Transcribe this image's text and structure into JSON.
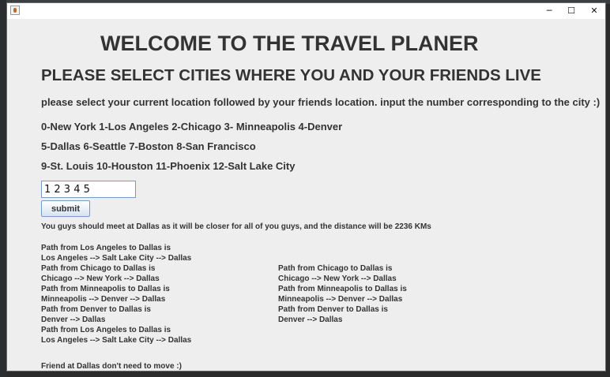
{
  "window": {
    "controls": {
      "minimize": "─",
      "maximize": "☐",
      "close": "✕"
    }
  },
  "header": {
    "title": "WELCOME TO THE TRAVEL PLANER",
    "subtitle": "PLEASE SELECT CITIES WHERE YOU AND YOUR FRIENDS LIVE",
    "instruction": "please select your current location followed by your friends location. input the number corresponding to the city :)"
  },
  "cities": [
    "0-New York 1-Los Angeles  2-Chicago 3- Minneapolis 4-Denver",
    "5-Dallas 6-Seattle 7-Boston 8-San Francisco",
    "9-St. Louis 10-Houston 11-Phoenix 12-Salt Lake City"
  ],
  "form": {
    "input_value": "1 2 3 4 5",
    "submit_label": "submit"
  },
  "result": "You guys should meet at Dallas as it will be closer for all of you guys, and the distance will be 2236 KMs",
  "paths_left": [
    "Path from Los Angeles to Dallas is",
    "Los Angeles --> Salt Lake City --> Dallas",
    "Path from Chicago to Dallas is",
    "Chicago --> New York --> Dallas",
    "Path from Minneapolis to Dallas is",
    "Minneapolis --> Denver --> Dallas",
    "Path from Denver to Dallas is",
    "Denver --> Dallas",
    "Path from Los Angeles to Dallas is",
    "Los Angeles --> Salt Lake City --> Dallas"
  ],
  "paths_right": [
    "Path from Chicago to Dallas is",
    "Chicago --> New York --> Dallas",
    "Path from Minneapolis to Dallas is",
    "Minneapolis --> Denver --> Dallas",
    "Path from Denver to Dallas is",
    "Denver --> Dallas"
  ],
  "footer_note": "Friend at Dallas don't need to move :)"
}
